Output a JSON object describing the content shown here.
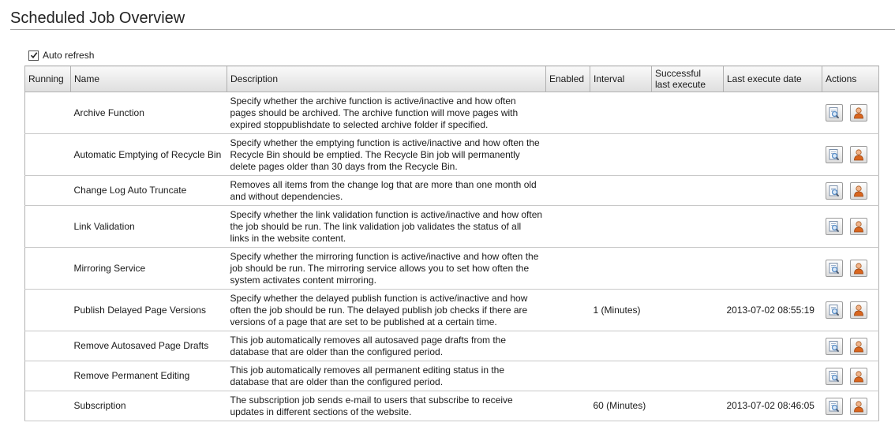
{
  "page": {
    "title": "Scheduled Job Overview",
    "auto_refresh_label": "Auto refresh",
    "auto_refresh_checked": true
  },
  "table": {
    "headers": {
      "running": "Running",
      "name": "Name",
      "description": "Description",
      "enabled": "Enabled",
      "interval": "Interval",
      "successful_line1": "Successful",
      "successful_line2": "last execute",
      "last_execute_date": "Last execute date",
      "actions": "Actions"
    },
    "rows": [
      {
        "name": "Archive Function",
        "description": "Specify whether the archive function is active/inactive and how often pages should be archived. The archive function will move pages with expired stoppublishdate to selected archive folder if specified.",
        "interval": "",
        "last_execute_date": ""
      },
      {
        "name": "Automatic Emptying of Recycle Bin",
        "description": "Specify whether the emptying function is active/inactive and how often the Recycle Bin should be emptied. The Recycle Bin job will permanently delete pages older than 30 days from the Recycle Bin.",
        "interval": "",
        "last_execute_date": ""
      },
      {
        "name": "Change Log Auto Truncate",
        "description": "Removes all items from the change log that are more than one month old and without dependencies.",
        "interval": "",
        "last_execute_date": ""
      },
      {
        "name": "Link Validation",
        "description": "Specify whether the link validation function is active/inactive and how often the job should be run. The link validation job validates the status of all links in the website content.",
        "interval": "",
        "last_execute_date": ""
      },
      {
        "name": "Mirroring Service",
        "description": "Specify whether the mirroring function is active/inactive and how often the job should be run. The mirroring service allows you to set how often the system activates content mirroring.",
        "interval": "",
        "last_execute_date": ""
      },
      {
        "name": "Publish Delayed Page Versions",
        "description": "Specify whether the delayed publish function is active/inactive and how often the job should be run. The delayed publish job checks if there are versions of a page that are set to be published at a certain time.",
        "interval": "1 (Minutes)",
        "last_execute_date": "2013-07-02 08:55:19"
      },
      {
        "name": "Remove Autosaved Page Drafts",
        "description": "This job automatically removes all autosaved page drafts from the database that are older than the configured period.",
        "interval": "",
        "last_execute_date": ""
      },
      {
        "name": "Remove Permanent Editing",
        "description": "This job automatically removes all permanent editing status in the database that are older than the configured period.",
        "interval": "",
        "last_execute_date": ""
      },
      {
        "name": "Subscription",
        "description": "The subscription job sends e-mail to users that subscribe to receive updates in different sections of the website.",
        "interval": "60 (Minutes)",
        "last_execute_date": "2013-07-02 08:46:05"
      }
    ]
  },
  "icons": {
    "details": "view-details-icon",
    "user": "user-icon"
  },
  "colors": {
    "user_icon_orange": "#d9661f",
    "details_icon_blue": "#5a8fc8"
  }
}
